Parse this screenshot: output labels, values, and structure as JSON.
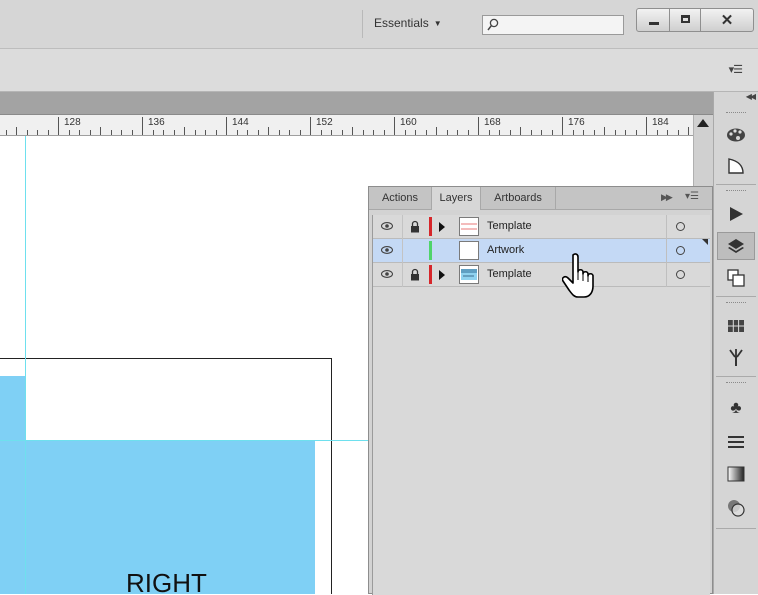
{
  "titlebar": {
    "workspace_label": "Essentials",
    "search": {
      "value": "",
      "placeholder": ""
    }
  },
  "ruler": {
    "labels": [
      "128",
      "136",
      "144",
      "152",
      "160",
      "168",
      "176",
      "184"
    ]
  },
  "canvas": {
    "artwork_text": "RIGHT",
    "guide_color": "#6ee0ee",
    "fill_color": "#7fd0f5"
  },
  "panel": {
    "tabs": [
      {
        "label": "Actions",
        "active": false
      },
      {
        "label": "Layers",
        "active": true
      },
      {
        "label": "Artboards",
        "active": false
      }
    ],
    "layers": [
      {
        "name": "Template",
        "visible": true,
        "locked": true,
        "expandable": true,
        "color": "#d6262a",
        "selected": false
      },
      {
        "name": "Artwork",
        "visible": true,
        "locked": false,
        "expandable": false,
        "color": "#4fd46a",
        "selected": true
      },
      {
        "name": "Template",
        "visible": true,
        "locked": true,
        "expandable": true,
        "color": "#d6262a",
        "selected": false
      }
    ]
  },
  "dock": {
    "icons": [
      "color-palette-icon",
      "color-guide-icon",
      "play-actions-icon",
      "layers-icon",
      "artboards-icon",
      "swatches-icon",
      "brushes-icon",
      "symbols-icon",
      "stroke-icon",
      "gradient-icon",
      "transparency-icon"
    ]
  },
  "colors": {
    "selection": "#c4d9f5",
    "layer_red": "#d6262a",
    "layer_green": "#4fd46a"
  }
}
